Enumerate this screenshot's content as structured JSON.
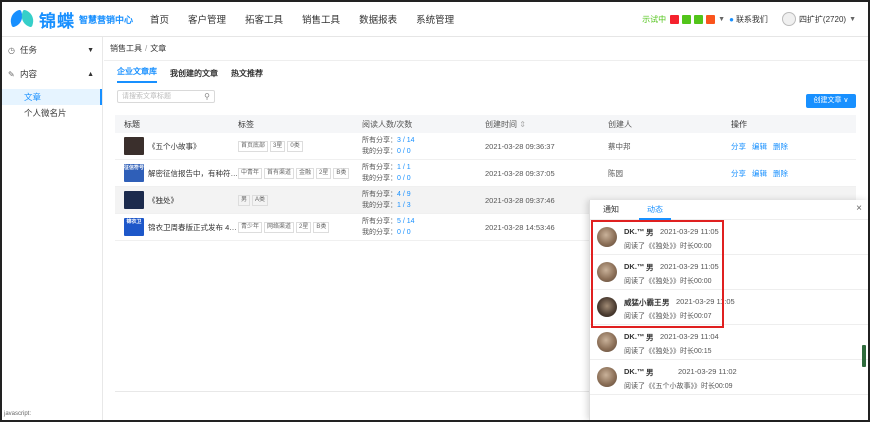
{
  "brand": {
    "name": "锦蝶",
    "subtitle": "智慧营销中心",
    "logo_color": "#1890ff"
  },
  "nav": [
    "首页",
    "客户管理",
    "拓客工具",
    "销售工具",
    "数据报表",
    "系统管理"
  ],
  "topbar": {
    "trial": "示试中",
    "quick_icons": [
      {
        "name": "red",
        "color": "#f5222d"
      },
      {
        "name": "green1",
        "color": "#52c41a"
      },
      {
        "name": "green2",
        "color": "#52c41a"
      },
      {
        "name": "orange",
        "color": "#fa541c"
      }
    ],
    "contact": "联系我们",
    "user": "四扩扩(2720)"
  },
  "sidebar": {
    "groups": [
      {
        "label": "任务",
        "icon": "clock-icon",
        "expanded": false
      },
      {
        "label": "内容",
        "icon": "edit-icon",
        "expanded": true
      }
    ],
    "items": [
      {
        "label": "文章",
        "active": true
      },
      {
        "label": "个人微名片",
        "active": false
      }
    ]
  },
  "breadcrumb": [
    "销售工具",
    "文章"
  ],
  "tabs": [
    {
      "label": "企业文章库",
      "active": true
    },
    {
      "label": "我创建的文章",
      "active": false
    },
    {
      "label": "热文推荐",
      "active": false
    }
  ],
  "search": {
    "placeholder": "请搜索文章标题"
  },
  "create_button": "创建文章",
  "table": {
    "headers": [
      "标题",
      "标签",
      "阅读人数/次数",
      "创建时间",
      "创建人",
      "操作"
    ],
    "sort_icon": "⇕",
    "rows": [
      {
        "title": "《五个小故事》",
        "thumb_color": "#3a2f2c",
        "tags": [
          "首页底部",
          "3星",
          "0类"
        ],
        "share_all_label": "所有分享：",
        "share_all": "3 / 14",
        "share_me_label": "我的分享：",
        "share_me": "0 / 0",
        "time": "2021-03-28 09:36:37",
        "creator": "蔡中邦",
        "actions": [
          "分享",
          "编辑",
          "删除"
        ],
        "highlight": false
      },
      {
        "title": "解密征信报告中，有种符号...",
        "thumb_color": "#2f5fb8",
        "thumb_text": "征信符号",
        "tags": [
          "中青年",
          "首有渠道",
          "金融",
          "2星",
          "B类"
        ],
        "share_all_label": "所有分享：",
        "share_all": "1 / 1",
        "share_me_label": "我的分享：",
        "share_me": "0 / 0",
        "time": "2021-03-28 09:37:05",
        "creator": "陈园",
        "actions": [
          "分享",
          "编辑",
          "删除"
        ],
        "highlight": false
      },
      {
        "title": "《独处》",
        "thumb_color": "#1c2b4d",
        "tags": [
          "男",
          "A类"
        ],
        "share_all_label": "所有分享：",
        "share_all": "4 / 9",
        "share_me_label": "我的分享：",
        "share_me": "1 / 3",
        "time": "2021-03-28 09:37:46",
        "creator": "",
        "actions": [],
        "highlight": true
      },
      {
        "title": "锦衣卫周春版正式发布 4980...",
        "thumb_color": "#1d57c9",
        "thumb_text": "锦衣卫",
        "tags": [
          "青少年",
          "网络渠道",
          "2星",
          "B类"
        ],
        "share_all_label": "所有分享：",
        "share_all": "5 / 14",
        "share_me_label": "我的分享：",
        "share_me": "0 / 0",
        "time": "2021-03-28 14:53:46",
        "creator": "",
        "actions": [],
        "highlight": false
      }
    ]
  },
  "panel": {
    "tabs": [
      {
        "label": "通知",
        "active": false
      },
      {
        "label": "动态",
        "active": true
      }
    ],
    "close": "×",
    "items": [
      {
        "name": "DK.™",
        "gender": "男",
        "time": "2021-03-29 11:05",
        "text": "阅读了《《独处》》时长00:00",
        "dark": false,
        "name_w": 18
      },
      {
        "name": "DK.™",
        "gender": "男",
        "time": "2021-03-29 11:05",
        "text": "阅读了《《独处》》时长00:00",
        "dark": false,
        "name_w": 18
      },
      {
        "name": "威猛小霸王",
        "gender": "男",
        "time": "2021-03-29 11:05",
        "text": "阅读了《《独处》》时长00:07",
        "dark": true,
        "name_w": 34
      },
      {
        "name": "DK.™",
        "gender": "男",
        "time": "2021-03-29 11:04",
        "text": "阅读了《《独处》》时长00:15",
        "dark": false,
        "name_w": 18
      },
      {
        "name": "DK.™",
        "gender": "男",
        "time": "2021-03-29 11:02",
        "text": "阅读了《《五个小故事》》时长00:09",
        "dark": false,
        "name_w": 18,
        "wide_gap": true
      }
    ]
  },
  "status_stub": "javascript:"
}
